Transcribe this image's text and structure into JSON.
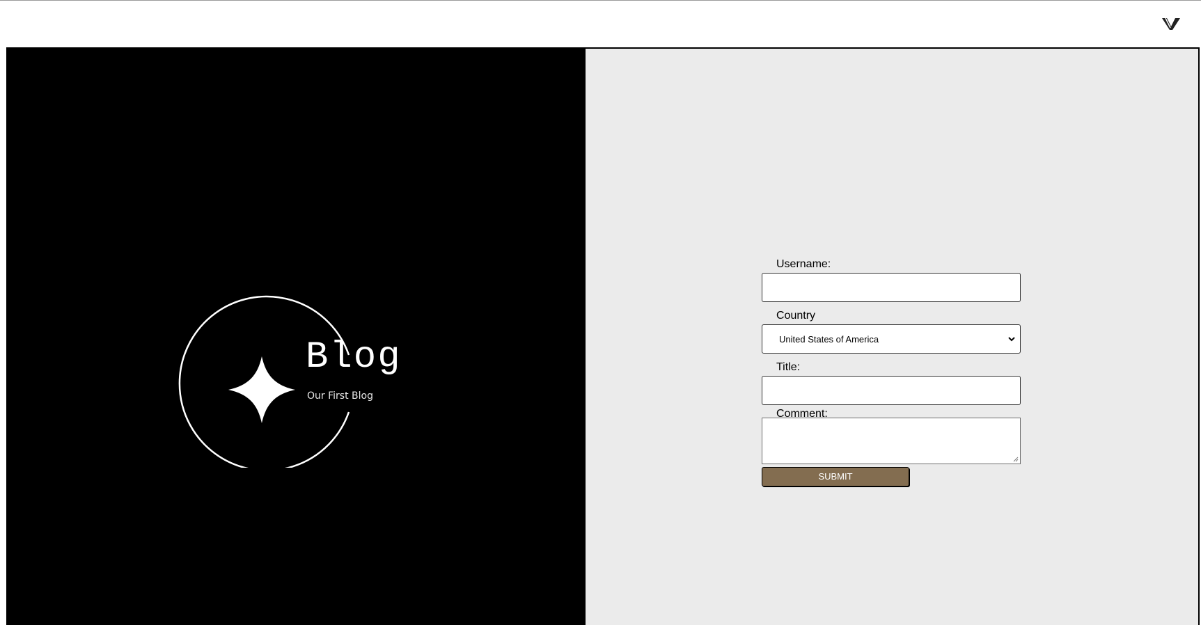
{
  "header": {
    "logo_icon": "v-logo-icon"
  },
  "brand": {
    "title": "Blog",
    "subtitle": "Our First Blog",
    "icon": "four-point-star-icon"
  },
  "form": {
    "username_label": "Username:",
    "username_value": "",
    "country_label": "Country",
    "country_selected": "United States of America",
    "title_label": "Title:",
    "title_value": "",
    "comment_label": "Comment:",
    "comment_value": "",
    "submit_label": "SUBMIT"
  },
  "colors": {
    "left_panel": "#000000",
    "right_panel": "#ebebeb",
    "submit_button": "#836d50"
  }
}
